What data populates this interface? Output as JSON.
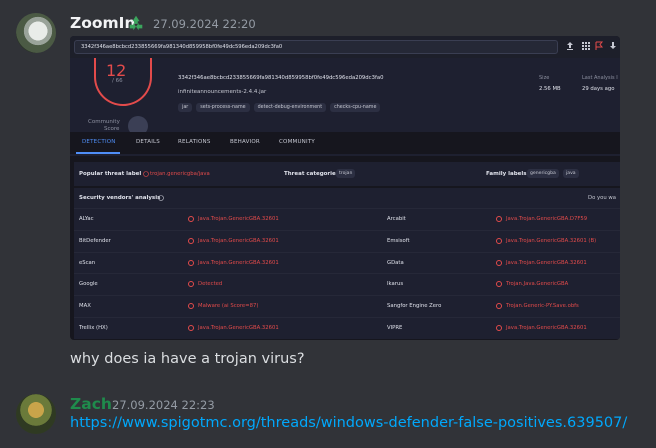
{
  "messages": [
    {
      "username": "ZoomIn",
      "badge": "recycle-badge-icon",
      "timestamp": "27.09.2024 22:20",
      "text": "why does ia have a trojan virus?"
    },
    {
      "username": "Zach",
      "timestamp": "27.09.2024 22:23",
      "link": "https://www.spigotmc.org/threads/windows-defender-false-positives.639507/"
    }
  ],
  "screenshot": {
    "search_value": "3342f346ae8bcbcd233855669fa981340d859958bf0fe49dc596eda209dc3fa0",
    "score": "12",
    "score_total": "/ 66",
    "community_score_label1": "Community",
    "community_score_label2": "Score",
    "hash": "3342f346ae8bcbcd233855669fa981340d859958bf0fe49dc596eda209dc3fa0",
    "filename": "infiniteannouncements-2.4.4.jar",
    "tags": [
      "jar",
      "sets-process-name",
      "detect-debug-environment",
      "checks-cpu-name"
    ],
    "size_label": "Size",
    "size_value": "2.56 MB",
    "last_analysis_label": "Last Analysis I",
    "last_analysis_value": "29 days ago",
    "tabs": [
      "DETECTION",
      "DETAILS",
      "RELATIONS",
      "BEHAVIOR",
      "COMMUNITY"
    ],
    "popular_threat_label": "Popular threat label",
    "popular_threat_value": "trojan.genericgba/java",
    "threat_categories_label": "Threat categories",
    "threat_categories_value": "trojan",
    "family_labels_label": "Family labels",
    "family_labels_values": [
      "genericgba",
      "java"
    ],
    "vendors_heading": "Security vendors' analysis",
    "vendors_right": "Do you wa",
    "vendors": [
      {
        "left_name": "ALYac",
        "left_result": "Java.Trojan.GenericGBA.32601",
        "right_name": "Arcabit",
        "right_result": "Java.Trojan.GenericGBA.D7F59"
      },
      {
        "left_name": "BitDefender",
        "left_result": "Java.Trojan.GenericGBA.32601",
        "right_name": "Emsisoft",
        "right_result": "Java.Trojan.GenericGBA.32601 (B)"
      },
      {
        "left_name": "eScan",
        "left_result": "Java.Trojan.GenericGBA.32601",
        "right_name": "GData",
        "right_result": "Java.Trojan.GenericGBA.32601"
      },
      {
        "left_name": "Google",
        "left_result": "Detected",
        "right_name": "Ikarus",
        "right_result": "Trojan.Java.GenericGBA"
      },
      {
        "left_name": "MAX",
        "left_result": "Malware (ai Score=87)",
        "right_name": "Sangfor Engine Zero",
        "right_result": "Trojan.Generic-PY.Save.obfs"
      },
      {
        "left_name": "Trellix (HX)",
        "left_result": "Java.Trojan.GenericGBA.32601",
        "right_name": "VIPRE",
        "right_result": "Java.Trojan.GenericGBA.32601"
      }
    ]
  },
  "colors": {
    "background": "#313338",
    "username_zach": "#1f8b4c",
    "link": "#00a8fc",
    "detection_red": "#e34b4b",
    "tab_active": "#4f8ef7"
  }
}
